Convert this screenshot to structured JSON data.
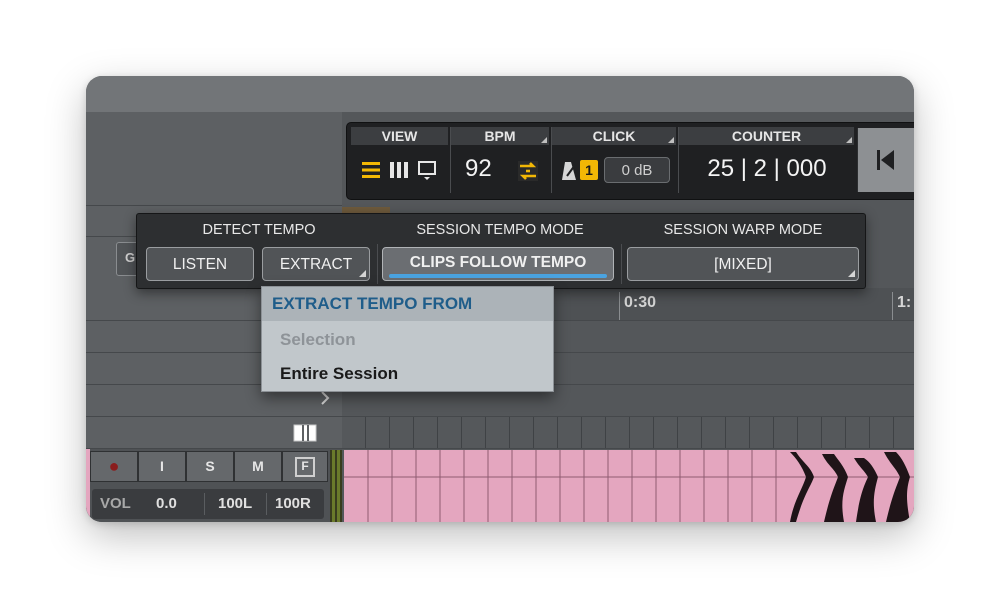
{
  "transport": {
    "view": {
      "label": "VIEW"
    },
    "bpm": {
      "label": "BPM",
      "value": "92"
    },
    "click": {
      "label": "CLICK",
      "level": "0 dB",
      "count_in_badge": "1"
    },
    "counter": {
      "label": "COUNTER",
      "value": "25 | 2 | 000"
    }
  },
  "tempo_panel": {
    "detect_tempo": {
      "label": "DETECT TEMPO",
      "listen": "LISTEN",
      "extract": "EXTRACT"
    },
    "session_tempo_mode": {
      "label": "SESSION TEMPO MODE",
      "value": "CLIPS FOLLOW TEMPO"
    },
    "session_warp_mode": {
      "label": "SESSION WARP MODE",
      "value": "[MIXED]"
    }
  },
  "extract_menu": {
    "header": "EXTRACT TEMPO FROM",
    "items": [
      {
        "label": "Selection",
        "enabled": false
      },
      {
        "label": "Entire Session",
        "enabled": true
      }
    ]
  },
  "timeline": {
    "marker_1": "0:30",
    "marker_2": "1:"
  },
  "track": {
    "buttons": {
      "record": "●",
      "input": "I",
      "solo": "S",
      "mute": "M",
      "fx": "F"
    },
    "vol_label": "VOL",
    "vol_value": "0.0",
    "pan_left": "100L",
    "pan_right": "100R",
    "partial_letter": "G"
  },
  "colors": {
    "accent_blue": "#4aa3e0",
    "yellow": "#f2b705",
    "clip_pink": "#e4a6bf",
    "menu_header": "#1f5d8a"
  }
}
